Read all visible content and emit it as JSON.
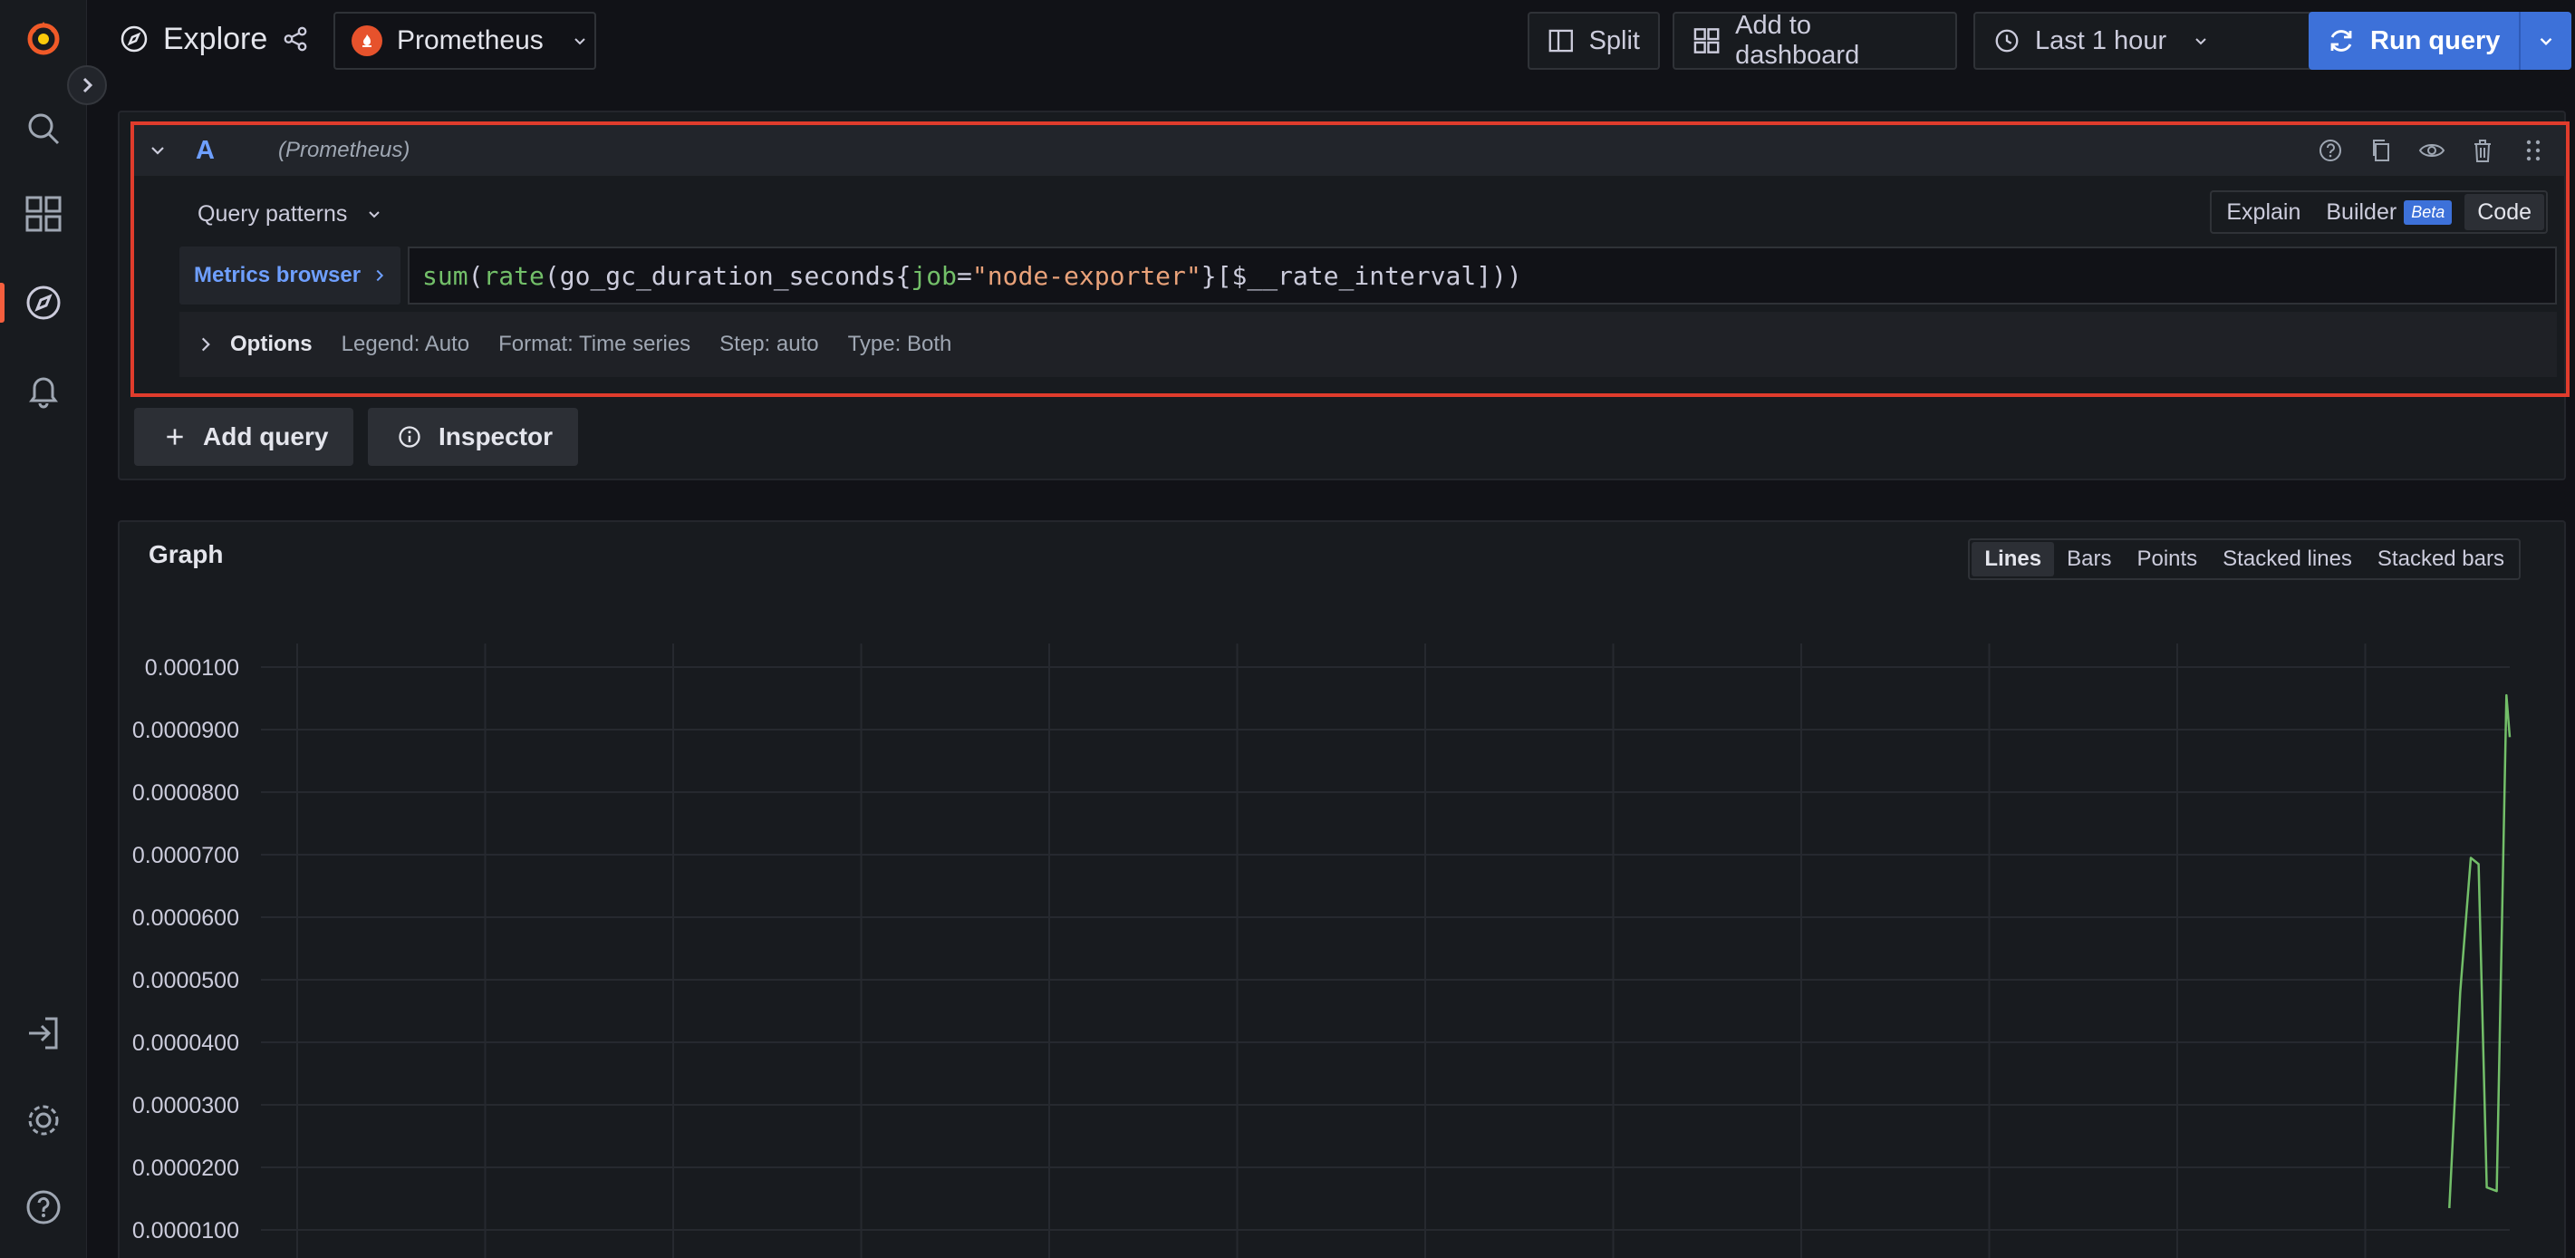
{
  "sidebar": {
    "items": [
      {
        "name": "grafana-logo-icon"
      },
      {
        "name": "search-icon"
      },
      {
        "name": "dashboards-icon"
      },
      {
        "name": "explore-icon",
        "active": true
      },
      {
        "name": "alerting-bell-icon"
      },
      {
        "name": "sign-in-icon"
      },
      {
        "name": "settings-gear-icon"
      },
      {
        "name": "help-icon"
      }
    ],
    "accent": "#f55f3e"
  },
  "topbar": {
    "title": "Explore",
    "datasource": "Prometheus",
    "split_label": "Split",
    "add_to_dashboard_label": "Add to dashboard",
    "time_range_label": "Last 1 hour",
    "run_query_label": "Run query",
    "run_color": "#3d71d9"
  },
  "query": {
    "ref": "A",
    "datasource_hint": "(Prometheus)",
    "query_patterns_label": "Query patterns",
    "modes": [
      {
        "label": "Explain",
        "active": false
      },
      {
        "label": "Builder",
        "badge": "Beta",
        "active": false
      },
      {
        "label": "Code",
        "active": true
      }
    ],
    "metrics_browser_label": "Metrics browser",
    "expr_parts": {
      "fn1": "sum",
      "p1": "(",
      "fn2": "rate",
      "p2": "(go_gc_duration_seconds{",
      "label": "job",
      "eq": "=",
      "str": "\"node-exporter\"",
      "rest": "}[$__rate_interval]))"
    },
    "options": {
      "label": "Options",
      "legend": "Legend: Auto",
      "format": "Format: Time series",
      "step": "Step: auto",
      "type": "Type: Both"
    },
    "highlight_color": "#e03c2c"
  },
  "actions": {
    "add_query_label": "Add query",
    "inspector_label": "Inspector"
  },
  "graph": {
    "title": "Graph",
    "vis_options": [
      {
        "label": "Lines",
        "active": true
      },
      {
        "label": "Bars",
        "active": false
      },
      {
        "label": "Points",
        "active": false
      },
      {
        "label": "Stacked lines",
        "active": false
      },
      {
        "label": "Stacked bars",
        "active": false
      }
    ]
  },
  "chart_data": {
    "type": "line",
    "title": "",
    "xlabel": "",
    "ylabel": "",
    "y_ticks": [
      "0.000100",
      "0.0000900",
      "0.0000800",
      "0.0000700",
      "0.0000600",
      "0.0000500",
      "0.0000400",
      "0.0000300",
      "0.0000200",
      "0.0000100"
    ],
    "ylim": [
      7.5e-06,
      0.0001
    ],
    "grid": true,
    "series": [
      {
        "color": "#73bf69",
        "x": [
          0.9727,
          0.9776,
          0.9824,
          0.9859,
          0.9896,
          0.9941,
          0.9985,
          1.0
        ],
        "y": [
          1.35e-05,
          4.8e-05,
          6.95e-05,
          6.85e-05,
          1.68e-05,
          1.62e-05,
          9.55e-05,
          8.88e-05
        ]
      }
    ]
  }
}
